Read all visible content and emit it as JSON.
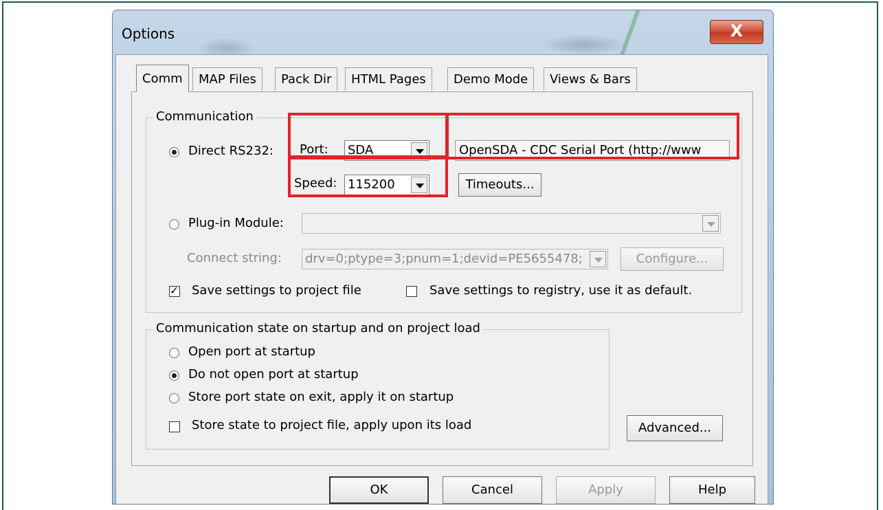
{
  "window": {
    "title": "Options",
    "close_glyph": "X"
  },
  "tabs": [
    "Comm",
    "MAP Files",
    "Pack Dir",
    "HTML Pages",
    "Demo Mode",
    "Views & Bars"
  ],
  "communication": {
    "legend": "Communication",
    "direct_label": "Direct RS232:",
    "port_label": "Port:",
    "port_value": "SDA",
    "port_description": "OpenSDA - CDC Serial Port (http://www",
    "speed_label": "Speed:",
    "speed_value": "115200",
    "timeouts_button": "Timeouts...",
    "plugin_label": "Plug-in Module:",
    "plugin_value": "",
    "connect_label": "Connect string:",
    "connect_value": "drv=0;ptype=3;pnum=1;devid=PE5655478;",
    "configure_button": "Configure...",
    "save_project_label": "Save settings to project file",
    "save_registry_label": "Save settings to registry, use it as default."
  },
  "startup": {
    "legend": "Communication state on startup and on project load",
    "open_label": "Open port at startup",
    "not_open_label": "Do not open port at startup",
    "store_exit_label": "Store port state on exit, apply it on startup",
    "store_project_label": "Store state to project file, apply upon its load"
  },
  "buttons": {
    "advanced": "Advanced...",
    "ok": "OK",
    "cancel": "Cancel",
    "apply": "Apply",
    "help": "Help"
  },
  "colors": {
    "highlight": "#e0242c",
    "close": "#c23a22"
  }
}
